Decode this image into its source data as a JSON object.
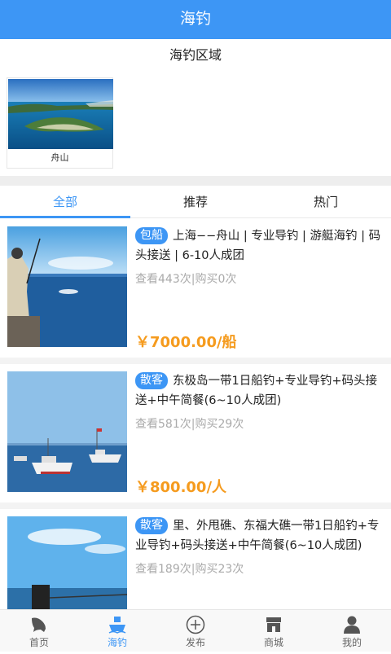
{
  "header": {
    "title": "海钓"
  },
  "areas": {
    "title": "海钓区域",
    "items": [
      {
        "label": "舟山"
      }
    ]
  },
  "tabs": [
    {
      "label": "全部"
    },
    {
      "label": "推荐"
    },
    {
      "label": "热门"
    }
  ],
  "listings": [
    {
      "badge": "包船",
      "title": "上海−−舟山 | 专业导钓 | 游艇海钓 | 码头接送 | 6-10人成团",
      "stats": "查看443次|购买0次",
      "price": "￥7000.00/船"
    },
    {
      "badge": "散客",
      "title": "东极岛一带1日船钓+专业导钓+码头接送+中午简餐(6~10人成团)",
      "stats": "查看581次|购买29次",
      "price": "￥800.00/人"
    },
    {
      "badge": "散客",
      "title": "里、外甩礁、东福大礁一带1日船钓+专业导钓+码头接送+中午简餐(6~10人成团)",
      "stats": "查看189次|购买23次",
      "price": ""
    }
  ],
  "tabbar": [
    {
      "label": "首页",
      "icon": "fish-icon"
    },
    {
      "label": "海钓",
      "icon": "boat-icon"
    },
    {
      "label": "发布",
      "icon": "plus-circle-icon"
    },
    {
      "label": "商城",
      "icon": "store-icon"
    },
    {
      "label": "我的",
      "icon": "user-icon"
    }
  ],
  "colors": {
    "accent": "#3d96f5",
    "price": "#f59b1e"
  }
}
